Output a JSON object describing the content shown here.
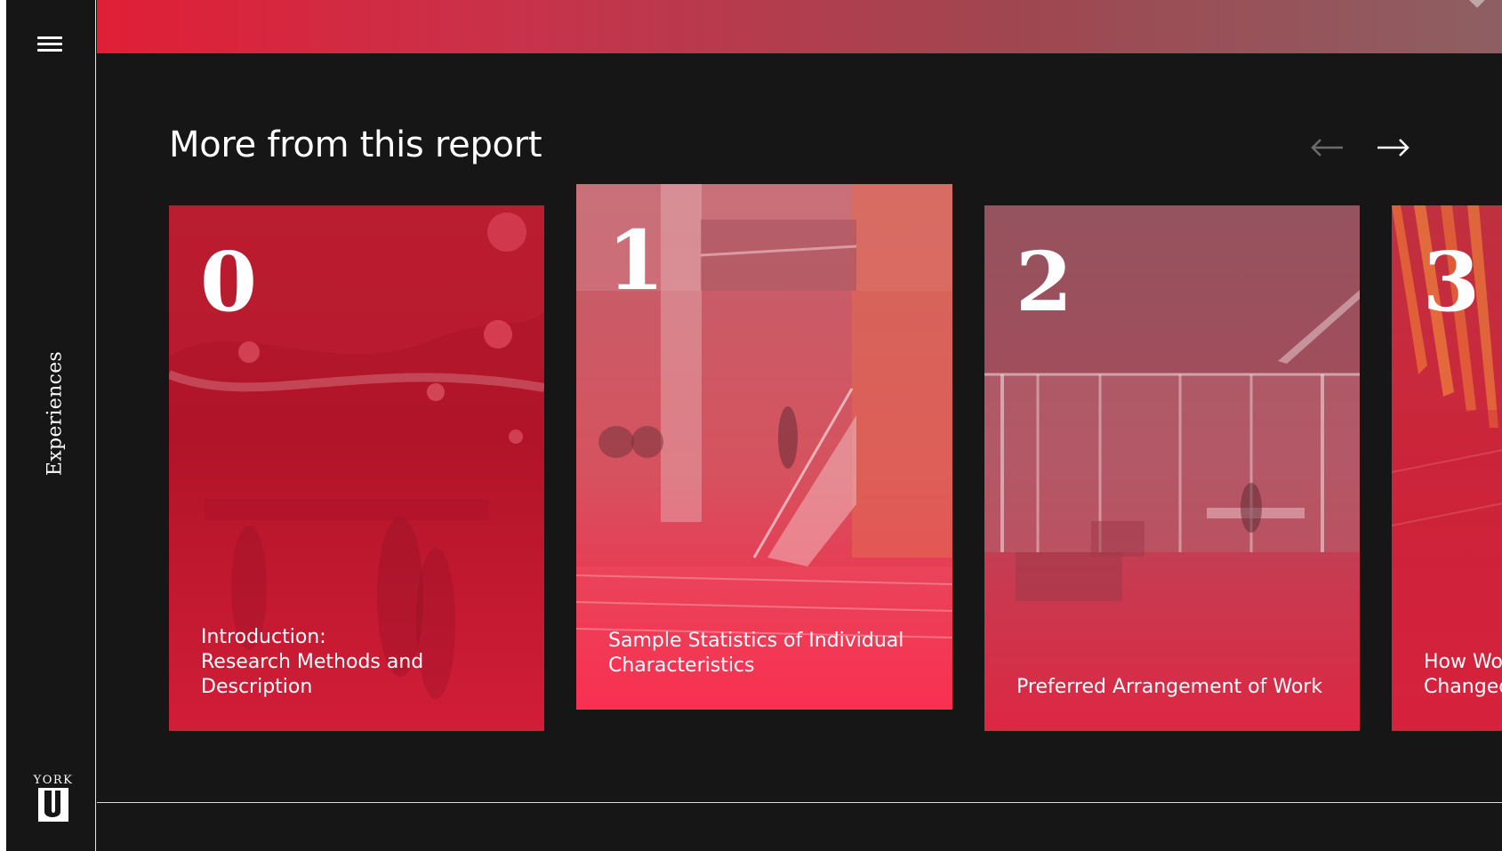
{
  "sidebar": {
    "menu_icon": "hamburger-menu-icon",
    "section_label": "Experiences",
    "logo": {
      "text": "YORK",
      "mark": "U"
    }
  },
  "section": {
    "title": "More from this report",
    "prev_icon": "arrow-left-icon",
    "next_icon": "arrow-right-icon"
  },
  "cards": [
    {
      "number": "0",
      "title_lines": [
        "Introduction:",
        "Research Methods and",
        "Description"
      ]
    },
    {
      "number": "1",
      "title_lines": [
        "Sample Statistics of Individual",
        "Characteristics"
      ]
    },
    {
      "number": "2",
      "title_lines": [
        "Preferred Arrangement of Work"
      ]
    },
    {
      "number": "3",
      "title_lines": [
        "How Wo",
        "Changed"
      ]
    }
  ],
  "colors": {
    "background": "#161616",
    "accent_red": "#e01f36",
    "text": "#ffffff"
  }
}
